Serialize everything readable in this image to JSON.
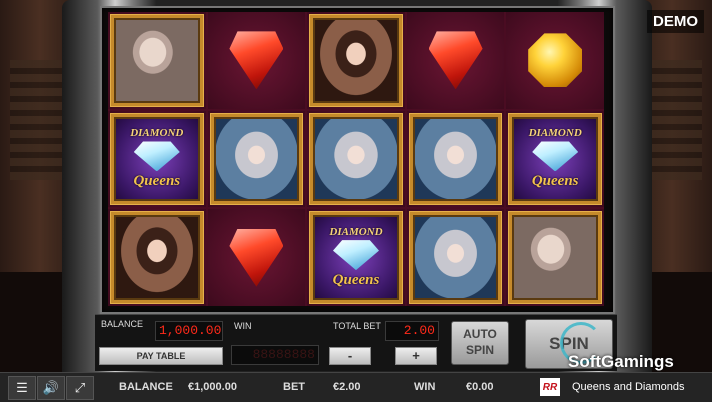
{
  "demo_badge": "DEMO",
  "panel": {
    "balance_label": "BALANCE",
    "balance_value": "1,000.00",
    "win_label": "WIN",
    "win_display": "88888888",
    "total_bet_label": "TOTAL BET",
    "total_bet_value": "2.00",
    "paytable_label": "PAY TABLE",
    "minus_label": "-",
    "plus_label": "+",
    "auto_spin_label": "AUTO\nSPIN",
    "spin_label": "SPIN"
  },
  "bottom_bar": {
    "balance_label": "BALANCE",
    "balance_value": "€1,000.00",
    "bet_label": "BET",
    "bet_value": "€2.00",
    "win_label": "WIN",
    "win_value": "€0.00",
    "provider_logo": "RR",
    "game_title": "Queens and Diamonds"
  },
  "watermark": "SoftGamings",
  "reels": [
    [
      "catherine",
      "red-gem",
      "sisi",
      "red-gem",
      "gold-gem"
    ],
    [
      "diamond-queens",
      "marie",
      "marie",
      "marie",
      "diamond-queens"
    ],
    [
      "sisi",
      "red-gem",
      "diamond-queens",
      "marie",
      "catherine"
    ]
  ],
  "diamond_queens_text": {
    "top": "DIAMOND",
    "bottom": "Queens"
  },
  "icons": {
    "menu": "menu-icon",
    "sound": "speaker-icon",
    "fullscreen": "fullscreen-icon"
  }
}
